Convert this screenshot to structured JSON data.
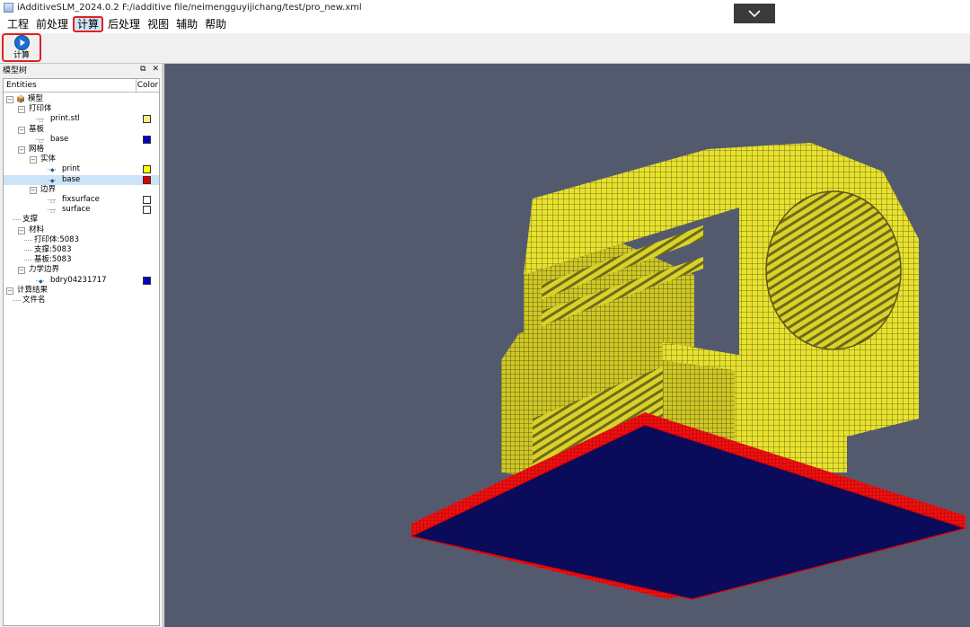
{
  "window": {
    "title": "iAdditiveSLM_2024.0.2 F:/iadditive file/neimengguyijichang/test/pro_new.xml"
  },
  "menu": [
    "工程",
    "前处理",
    "计算",
    "后处理",
    "视图",
    "辅助",
    "帮助"
  ],
  "toolbar": {
    "calc_label": "计算"
  },
  "dock": {
    "title": "模型树",
    "float_icon": "restore-icon",
    "close_icon": "close-icon"
  },
  "tree": {
    "headers": {
      "entities": "Entities",
      "color": "Color"
    },
    "rows": [
      {
        "label": "模型",
        "indent": 0,
        "expander": "−",
        "icon": "model-icon"
      },
      {
        "label": "打印体",
        "indent": 1,
        "expander": "−"
      },
      {
        "label": "print.stl",
        "indent": 3,
        "leaf": "hollow",
        "color": "#f5ef8a"
      },
      {
        "label": "基板",
        "indent": 1,
        "expander": "−"
      },
      {
        "label": "base",
        "indent": 3,
        "leaf": "hollow",
        "color": "#0000c8"
      },
      {
        "label": "网格",
        "indent": 1,
        "expander": "−"
      },
      {
        "label": "实体",
        "indent": 2,
        "expander": "−"
      },
      {
        "label": "print",
        "indent": 4,
        "leaf": "filled",
        "color": "#ffff00"
      },
      {
        "label": "base",
        "indent": 4,
        "leaf": "filled",
        "color": "#e00000",
        "selected": true
      },
      {
        "label": "边界",
        "indent": 2,
        "expander": "−"
      },
      {
        "label": "fixsurface",
        "indent": 4,
        "leaf": "hollow",
        "color": "#ffffff"
      },
      {
        "label": "surface",
        "indent": 4,
        "leaf": "hollow",
        "color": "#ffffff"
      },
      {
        "label": "支撑",
        "indent": 1
      },
      {
        "label": "材料",
        "indent": 1,
        "expander": "−"
      },
      {
        "label": "打印体:5083",
        "indent": 2
      },
      {
        "label": "支撑:5083",
        "indent": 2
      },
      {
        "label": "基板:5083",
        "indent": 2
      },
      {
        "label": "力学边界",
        "indent": 1,
        "expander": "−"
      },
      {
        "label": "bdry04231717",
        "indent": 3,
        "leaf": "filled",
        "color": "#0000c8"
      },
      {
        "label": "计算结果",
        "indent": 0,
        "expander": "−"
      },
      {
        "label": "文件名",
        "indent": 1
      }
    ]
  },
  "viewport": {
    "background": "#545a6e",
    "part_color": "#e6e02a",
    "base_top_color": "#0b0b5c",
    "base_edge_color": "#e00000"
  },
  "colors": {
    "highlight_box": "#e02020",
    "selection": "#cce4f7"
  }
}
